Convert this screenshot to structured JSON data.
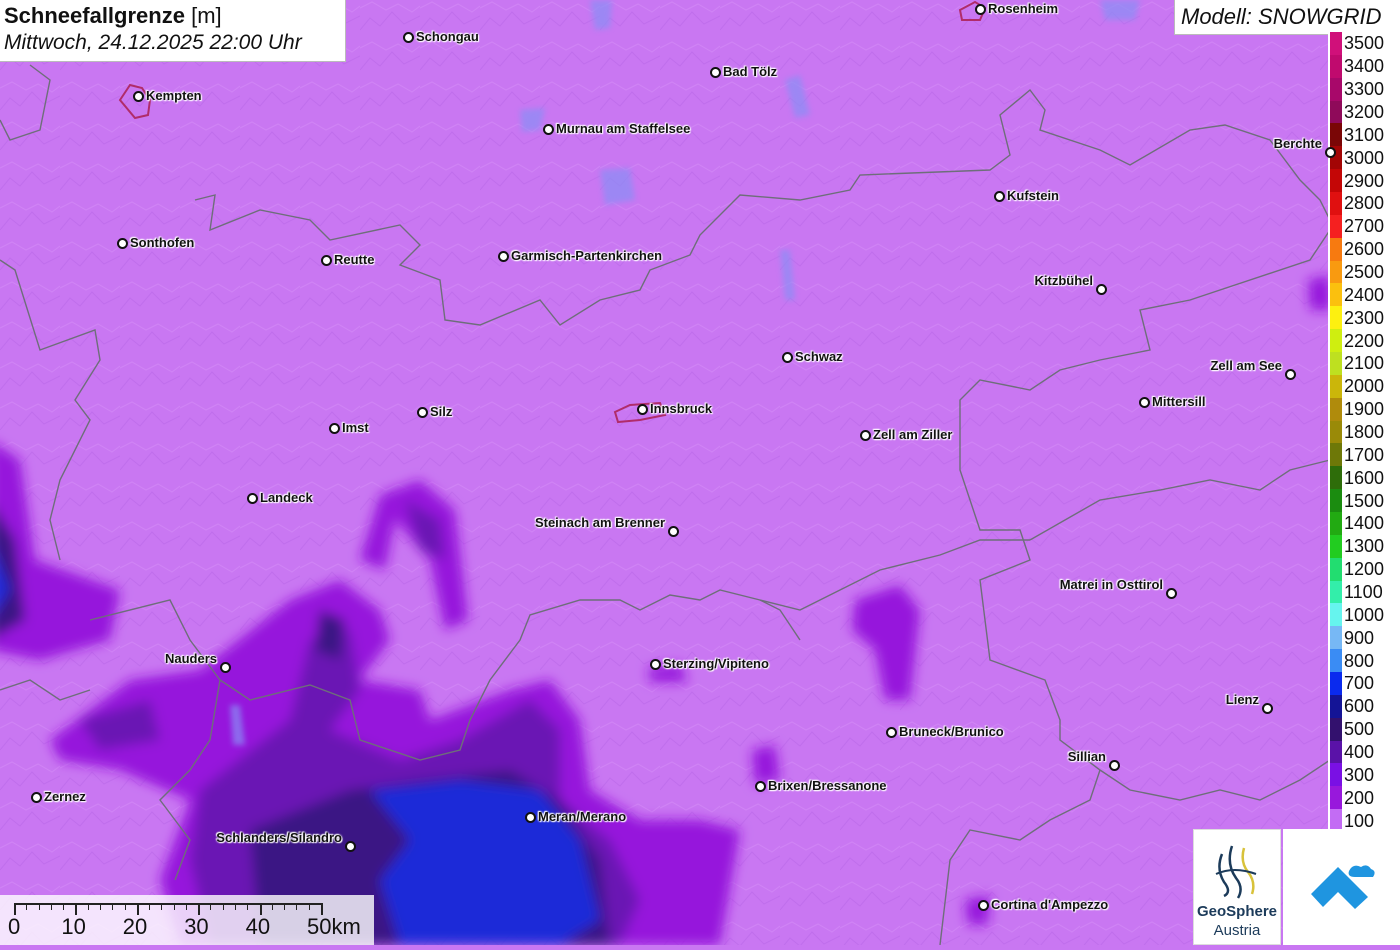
{
  "title": {
    "variable": "Schneefallgrenze",
    "unit": "[m]",
    "datetime": "Mittwoch, 24.12.2025 22:00 Uhr"
  },
  "model_label": "Modell: SNOWGRID",
  "legend": {
    "labels": [
      "3500",
      "3400",
      "3300",
      "3200",
      "3100",
      "3000",
      "2900",
      "2800",
      "2700",
      "2600",
      "2500",
      "2400",
      "2300",
      "2200",
      "2100",
      "2000",
      "1900",
      "1800",
      "1700",
      "1600",
      "1500",
      "1400",
      "1300",
      "1200",
      "1100",
      "1000",
      "900",
      "800",
      "700",
      "600",
      "500",
      "400",
      "300",
      "200",
      "100"
    ],
    "colors": [
      "#d0107a",
      "#c00a6e",
      "#a8086a",
      "#8f0a5a",
      "#7a0606",
      "#a30505",
      "#c40606",
      "#e01010",
      "#f52020",
      "#f77a10",
      "#f99a10",
      "#fbc00e",
      "#fdf010",
      "#cfee10",
      "#bee020",
      "#cbb60a",
      "#b08b0c",
      "#9a8a08",
      "#6e7808",
      "#2e6d0a",
      "#1b8c10",
      "#22aa12",
      "#22cc20",
      "#22dd70",
      "#33eeaa",
      "#66f4ee",
      "#77b8f5",
      "#3a8cf4",
      "#0a2aee",
      "#141496",
      "#33116e",
      "#5a12a8",
      "#7a10e4",
      "#9818dc",
      "#c36cf4"
    ]
  },
  "cities": [
    {
      "name": "Rosenheim",
      "side": "right"
    },
    {
      "name": "Schongau",
      "side": "right"
    },
    {
      "name": "Kempten",
      "side": "right"
    },
    {
      "name": "Bad Tölz",
      "side": "right"
    },
    {
      "name": "Murnau am Staffelsee",
      "side": "right"
    },
    {
      "name": "Berchte",
      "side": "left"
    },
    {
      "name": "Kufstein",
      "side": "right"
    },
    {
      "name": "Sonthofen",
      "side": "right"
    },
    {
      "name": "Reutte",
      "side": "right"
    },
    {
      "name": "Garmisch-Partenkirchen",
      "side": "right"
    },
    {
      "name": "Kitzbühel",
      "side": "left"
    },
    {
      "name": "Schwaz",
      "side": "right"
    },
    {
      "name": "Zell am See",
      "side": "left"
    },
    {
      "name": "Mittersill",
      "side": "right"
    },
    {
      "name": "Silz",
      "side": "right"
    },
    {
      "name": "Innsbruck",
      "side": "right"
    },
    {
      "name": "Imst",
      "side": "right"
    },
    {
      "name": "Zell am Ziller",
      "side": "right"
    },
    {
      "name": "Landeck",
      "side": "right"
    },
    {
      "name": "Steinach am Brenner",
      "side": "left"
    },
    {
      "name": "Matrei in Osttirol",
      "side": "left"
    },
    {
      "name": "Nauders",
      "side": "left"
    },
    {
      "name": "Sterzing/Vipiteno",
      "side": "right"
    },
    {
      "name": "Lienz",
      "side": "left"
    },
    {
      "name": "Bruneck/Brunico",
      "side": "right"
    },
    {
      "name": "Sillian",
      "side": "left"
    },
    {
      "name": "Brixen/Bressanone",
      "side": "right"
    },
    {
      "name": "Zernez",
      "side": "right"
    },
    {
      "name": "Meran/Merano",
      "side": "right"
    },
    {
      "name": "Schlanders/Silandro",
      "side": "left"
    },
    {
      "name": "Cortina d'Ampezzo",
      "side": "right"
    }
  ],
  "scalebar": {
    "labels": [
      "0",
      "10",
      "20",
      "30",
      "40",
      "50km"
    ]
  },
  "logos": {
    "geosphere_name": "GeoSphere",
    "geosphere_country": "Austria"
  },
  "colors": {
    "base": "#c977f2",
    "border": "#6e6e7a"
  }
}
